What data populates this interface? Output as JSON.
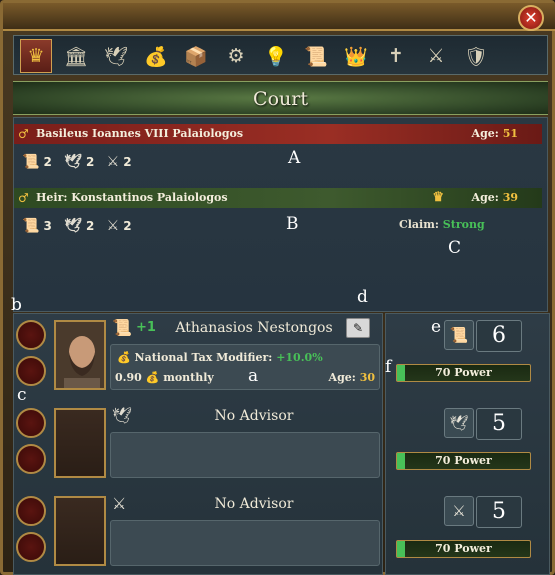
{
  "window": {
    "title": "Court",
    "close_icon": "close-icon"
  },
  "tabs": [
    {
      "icon": "crown-icon",
      "glyph": "♛",
      "active": true
    },
    {
      "icon": "government-building-icon",
      "glyph": "🏛",
      "active": false
    },
    {
      "icon": "dove-icon",
      "glyph": "🕊",
      "active": false
    },
    {
      "icon": "money-sacks-icon",
      "glyph": "💰",
      "active": false
    },
    {
      "icon": "trade-goods-icon",
      "glyph": "📦",
      "active": false
    },
    {
      "icon": "gears-icon",
      "glyph": "⚙",
      "active": false
    },
    {
      "icon": "idea-lightbulb-icon",
      "glyph": "💡",
      "active": false
    },
    {
      "icon": "scroll-icon",
      "glyph": "📜",
      "active": false
    },
    {
      "icon": "estates-crown-icon",
      "glyph": "👑",
      "active": false
    },
    {
      "icon": "religion-cross-icon",
      "glyph": "✝",
      "active": false
    },
    {
      "icon": "military-helmet-icon",
      "glyph": "⚔",
      "active": false
    },
    {
      "icon": "shield-crest-icon",
      "glyph": "🛡",
      "active": false
    }
  ],
  "ruler": {
    "name": "Basileus Ioannes VIII Palaiologos",
    "age_label": "Age:",
    "age": "51",
    "adm": "2",
    "dip": "2",
    "mil": "2"
  },
  "heir": {
    "name": "Heir: Konstantinos Palaiologos",
    "age_label": "Age:",
    "age": "39",
    "adm": "3",
    "dip": "2",
    "mil": "2",
    "claim_label": "Claim:",
    "claim_value": "Strong"
  },
  "markers": {
    "A": "A",
    "B": "B",
    "C": "C",
    "a": "a",
    "b": "b",
    "c": "c",
    "d": "d",
    "e": "e",
    "f": "f"
  },
  "advisors": [
    {
      "type_icon": "administrative-scroll-icon",
      "skill_bonus": "+1",
      "name": "Athanasios Nestongos",
      "modifier_label": "National Tax Modifier:",
      "modifier_value": "+10.0%",
      "cost": "0.90",
      "cost_period": "monthly",
      "age_label": "Age:",
      "age": "30"
    },
    {
      "type_icon": "diplomatic-dove-icon",
      "name": "No Advisor"
    },
    {
      "type_icon": "military-swords-icon",
      "name": "No Advisor"
    }
  ],
  "power": [
    {
      "type": "administrative",
      "icon": "administrative-scroll-icon",
      "value": "6",
      "bar_label": "70 Power",
      "bar_fraction": 0.06
    },
    {
      "type": "diplomatic",
      "icon": "diplomatic-dove-icon",
      "value": "5",
      "bar_label": "70 Power",
      "bar_fraction": 0.06
    },
    {
      "type": "military",
      "icon": "military-swords-icon",
      "value": "5",
      "bar_label": "70 Power",
      "bar_fraction": 0.06
    }
  ]
}
